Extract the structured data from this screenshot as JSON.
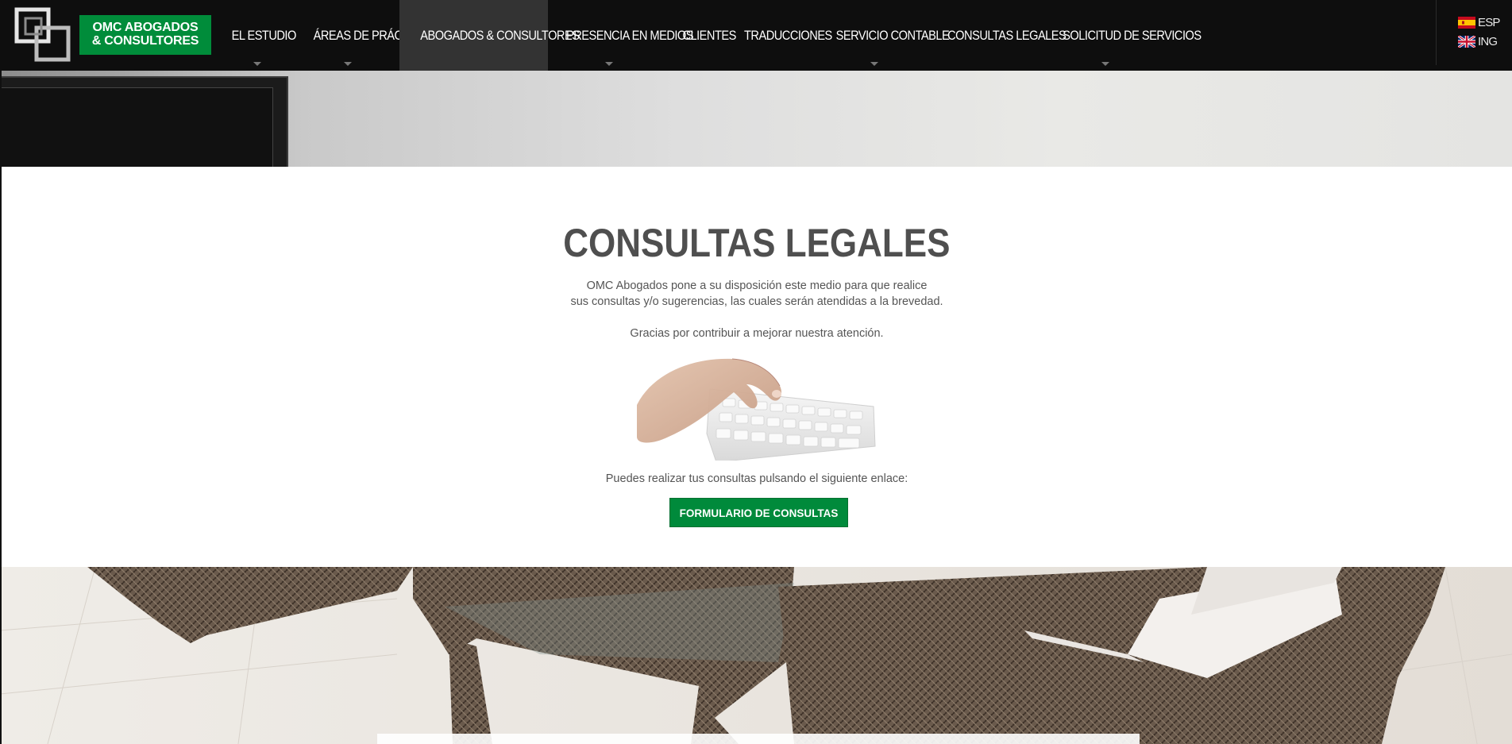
{
  "header": {
    "logo_line1": "OMC ABOGADOS",
    "logo_line2": "& CONSULTORES",
    "nav": [
      {
        "label": "EL ESTUDIO",
        "has_dropdown": true,
        "active": false
      },
      {
        "label": "ÁREAS DE PRÁCTICA",
        "has_dropdown": true,
        "active": false
      },
      {
        "label": "ABOGADOS & CONSULTORES",
        "has_dropdown": false,
        "active": true
      },
      {
        "label": "PRESENCIA EN MEDIOS",
        "has_dropdown": true,
        "active": false
      },
      {
        "label": "CLIENTES",
        "has_dropdown": false,
        "active": false
      },
      {
        "label": "TRADUCCIONES",
        "has_dropdown": false,
        "active": false
      },
      {
        "label": "SERVICIO CONTABLE",
        "has_dropdown": true,
        "active": false
      },
      {
        "label": "CONSULTAS LEGALES",
        "has_dropdown": false,
        "active": false
      },
      {
        "label": "SOLICITUD DE SERVICIOS",
        "has_dropdown": true,
        "active": false
      }
    ],
    "languages": [
      {
        "code": "ESP",
        "flag": "spain-flag-icon"
      },
      {
        "code": "ING",
        "flag": "uk-flag-icon"
      }
    ]
  },
  "main": {
    "title": "CONSULTAS LEGALES",
    "intro_line1": "OMC Abogados pone a su disposición este medio para que realice",
    "intro_line2": "sus consultas y/o sugerencias, las cuales serán atendidas a la brevedad.",
    "thanks": "Gracias por contribuir a mejorar nuestra atención.",
    "link_text": "Puedes realizar tus consultas pulsando el siguiente enlace:",
    "button_label": "FORMULARIO DE CONSULTAS"
  },
  "colors": {
    "header_bg": "#0e0e0e",
    "brand_green": "#008c3a",
    "active_nav_bg": "#333333",
    "title_gray": "#4f4f4f"
  }
}
